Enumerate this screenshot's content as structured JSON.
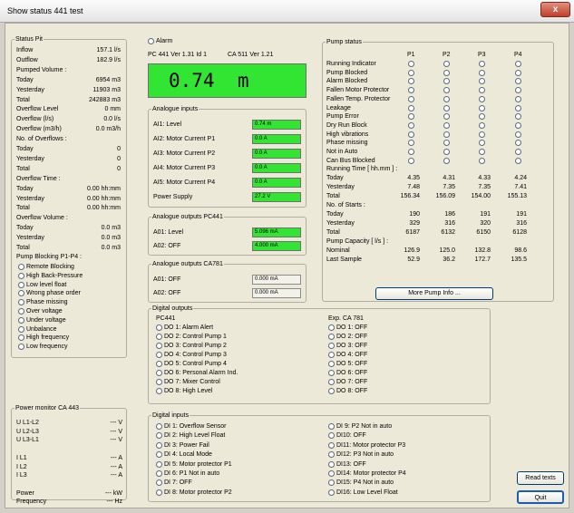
{
  "window": {
    "title": "Show status 441 test",
    "close_glyph": "x"
  },
  "status_pit": {
    "legend": "Status Pit",
    "rows": [
      {
        "label": "Inflow",
        "value": "157.1 l/s"
      },
      {
        "label": "Outflow",
        "value": "182.9 l/s"
      },
      {
        "label": "Pumped Volume :",
        "value": ""
      },
      {
        "label": "Today",
        "value": "6954 m3"
      },
      {
        "label": "Yesterday",
        "value": "11903 m3"
      },
      {
        "label": "Total",
        "value": "242883 m3"
      },
      {
        "label": "Overflow Level",
        "value": "0 mm"
      },
      {
        "label": "Overflow (l/s)",
        "value": "0.0 l/s"
      },
      {
        "label": "Overflow (m3/h)",
        "value": "0.0 m3/h"
      },
      {
        "label": "No. of Overflows :",
        "value": ""
      },
      {
        "label": "Today",
        "value": "0"
      },
      {
        "label": "Yesterday",
        "value": "0"
      },
      {
        "label": "Total",
        "value": "0"
      },
      {
        "label": "Overflow Time :",
        "value": ""
      },
      {
        "label": "Today",
        "value": "0.00 hh:mm"
      },
      {
        "label": "Yesterday",
        "value": "0.00 hh:mm"
      },
      {
        "label": "Total",
        "value": "0.00 hh:mm"
      },
      {
        "label": "Overflow Volume :",
        "value": ""
      },
      {
        "label": "Today",
        "value": "0.0 m3"
      },
      {
        "label": "Yesterday",
        "value": "0.0 m3"
      },
      {
        "label": "Total",
        "value": "0.0 m3"
      }
    ],
    "blocking_title": "Pump Blocking P1-P4 :",
    "blocking": [
      "Remote Blocking",
      "High Back-Pressure",
      "Low level float",
      "Wrong phase order",
      "Phase missing",
      "Over voltage",
      "Under voltage",
      "Unbalance",
      "High frequency",
      "Low frequency"
    ]
  },
  "power_monitor": {
    "legend": "Power monitor CA 443",
    "rows": [
      {
        "label": "U L1-L2",
        "value": "--- V"
      },
      {
        "label": "U L2-L3",
        "value": "--- V"
      },
      {
        "label": "U L3-L1",
        "value": "--- V"
      },
      {
        "label": "",
        "value": ""
      },
      {
        "label": "I L1",
        "value": "--- A"
      },
      {
        "label": "I L2",
        "value": "--- A"
      },
      {
        "label": "I L3",
        "value": "--- A"
      },
      {
        "label": "",
        "value": ""
      },
      {
        "label": "Power",
        "value": "--- kW"
      },
      {
        "label": "Frequency",
        "value": "--- Hz"
      }
    ]
  },
  "alarm_label": "Alarm",
  "version": {
    "pc": "PC 441 Ver 1.31  Id 1",
    "ca": "CA 511 Ver 1.21"
  },
  "level_display": "0.74  m",
  "analogue_inputs": {
    "legend": "Analogue inputs",
    "rows": [
      {
        "label": "AI1: Level",
        "value": "0.74 m"
      },
      {
        "label": "AI2: Motor Current P1",
        "value": "0.0 A"
      },
      {
        "label": "AI3: Motor Current P2",
        "value": "0.0 A"
      },
      {
        "label": "AI4: Motor Current P3",
        "value": "0.0 A"
      },
      {
        "label": "AI5: Motor Current P4",
        "value": "0.0 A"
      },
      {
        "label": "Power Supply",
        "value": "27.2 V"
      }
    ]
  },
  "analogue_out_pc": {
    "legend": "Analogue outputs PC441",
    "rows": [
      {
        "label": "A01: Level",
        "value": "5.096 mA"
      },
      {
        "label": "A02: OFF",
        "value": "4.000 mA"
      }
    ]
  },
  "analogue_out_ca": {
    "legend": "Analogue outputs CA781",
    "rows": [
      {
        "label": "A01: OFF",
        "value": "0.000 mA"
      },
      {
        "label": "A02: OFF",
        "value": "0.000 mA"
      }
    ]
  },
  "pump_status": {
    "legend": "Pump status",
    "columns": [
      "P1",
      "P2",
      "P3",
      "P4"
    ],
    "indicators": [
      "Running Indicator",
      "Pump Blocked",
      "Alarm Blocked",
      "Fallen Motor Protector",
      "Fallen Temp. Protector",
      "Leakage",
      "Pump Error",
      "Dry Run Block",
      "High vibrations",
      "Phase missing",
      "Not in Auto",
      "Can Bus Blocked"
    ],
    "stats": [
      {
        "label": "Running Time [ hh.mm ] :",
        "values": [
          "",
          "",
          "",
          ""
        ]
      },
      {
        "label": "Today",
        "values": [
          "4.35",
          "4.31",
          "4.33",
          "4.24"
        ]
      },
      {
        "label": "Yesterday",
        "values": [
          "7.48",
          "7.35",
          "7.35",
          "7.41"
        ]
      },
      {
        "label": "Total",
        "values": [
          "156.34",
          "156.09",
          "154.00",
          "155.13"
        ]
      },
      {
        "label": "No. of Starts :",
        "values": [
          "",
          "",
          "",
          ""
        ]
      },
      {
        "label": "Today",
        "values": [
          "190",
          "186",
          "191",
          "191"
        ]
      },
      {
        "label": "Yesterday",
        "values": [
          "329",
          "316",
          "320",
          "316"
        ]
      },
      {
        "label": "Total",
        "values": [
          "6187",
          "6132",
          "6150",
          "6128"
        ]
      },
      {
        "label": "Pump Capacity [ l/s ] :",
        "values": [
          "",
          "",
          "",
          ""
        ]
      },
      {
        "label": "Nominal",
        "values": [
          "126.9",
          "125.0",
          "132.8",
          "98.6"
        ]
      },
      {
        "label": "Last Sample",
        "values": [
          "52.9",
          "36.2",
          "172.7",
          "135.5"
        ]
      }
    ],
    "more_button": "More Pump Info ..."
  },
  "digital_outputs": {
    "legend": "Digital outputs",
    "pc_title": "PC441",
    "pc": [
      "DO 1: Alarm Alert",
      "DO 2: Control Pump 1",
      "DO 3: Control Pump 2",
      "DO 4: Control Pump 3",
      "DO 5: Control Pump 4",
      "DO 6: Personal Alarm Ind.",
      "DO 7: Mixer Control",
      "DO 8: High Level"
    ],
    "ca_title": "Exp. CA 781",
    "ca": [
      "DO 1: OFF",
      "DO 2: OFF",
      "DO 3: OFF",
      "DO 4: OFF",
      "DO 5: OFF",
      "DO 6: OFF",
      "DO 7: OFF",
      "DO 8: OFF"
    ]
  },
  "digital_inputs": {
    "legend": "Digital inputs",
    "left": [
      "DI 1: Overflow Sensor",
      "DI 2: High Level Float",
      "DI 3: Power Fail",
      "DI 4: Local Mode",
      "DI 5: Motor protector P1",
      "DI 6: P1 Not in auto",
      "DI 7: OFF",
      "DI 8: Motor protector P2"
    ],
    "right": [
      "DI 9: P2 Not in auto",
      "DI10: OFF",
      "DI11: Motor protector P3",
      "DI12: P3 Not in auto",
      "DI13: OFF",
      "DI14: Motor protector P4",
      "DI15: P4 Not in auto",
      "DI16: Low Level Float"
    ]
  },
  "buttons": {
    "read_texts": "Read texts",
    "quit": "Quit"
  }
}
